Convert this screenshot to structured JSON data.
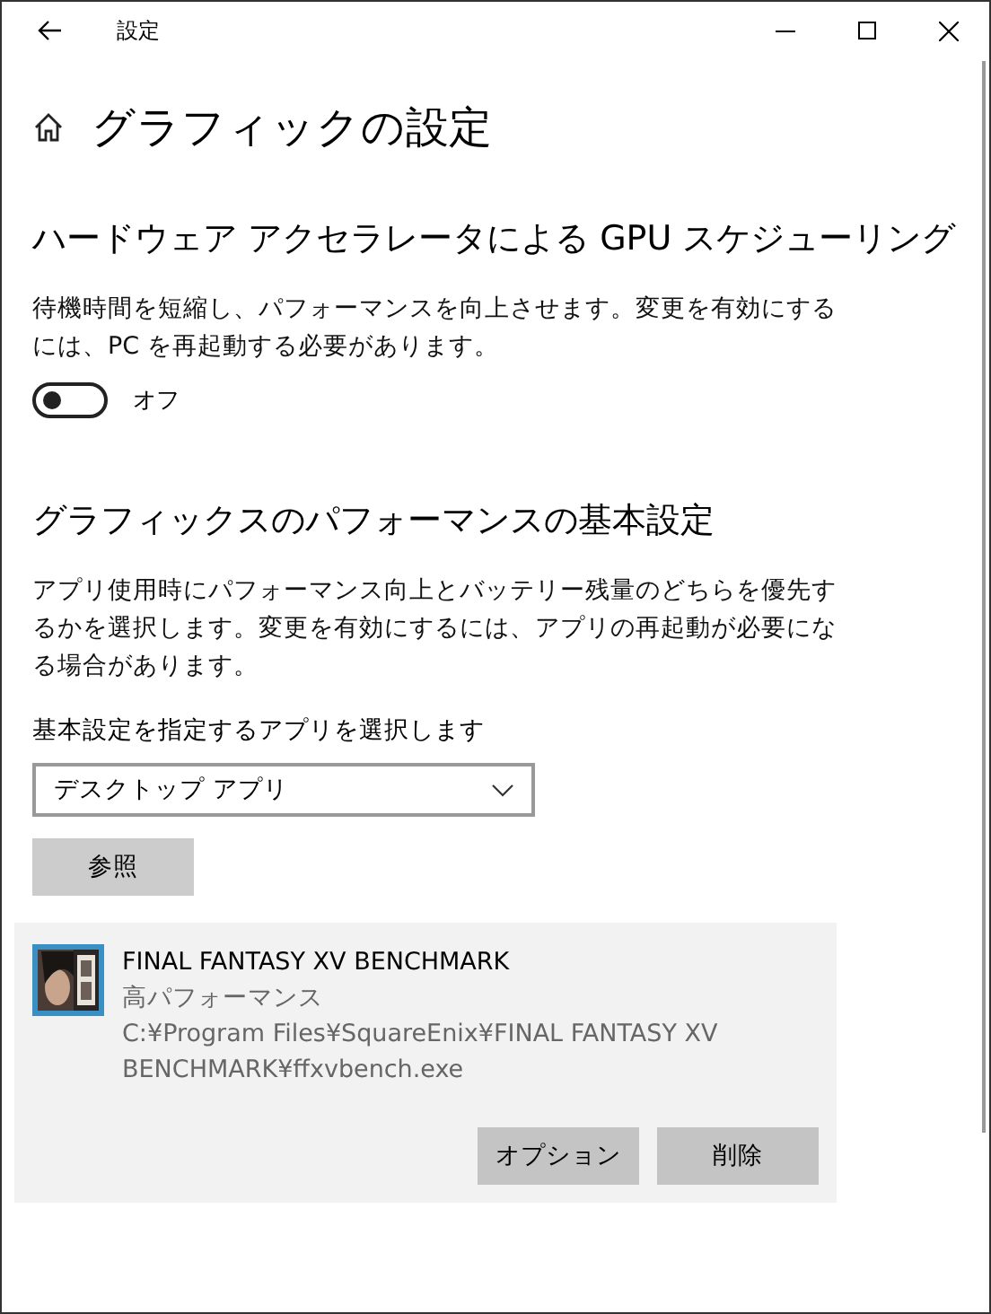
{
  "window": {
    "title": "設定"
  },
  "page_title": "グラフィックの設定",
  "gpu_scheduling": {
    "heading": "ハードウェア アクセラレータによる GPU スケジューリング",
    "description": "待機時間を短縮し、パフォーマンスを向上させます。変更を有効にするには、PC を再起動する必要があります。",
    "toggle": {
      "on": false,
      "label": "オフ"
    }
  },
  "performance": {
    "heading": "グラフィックスのパフォーマンスの基本設定",
    "description": "アプリ使用時にパフォーマンス向上とバッテリー残量のどちらを優先するかを選択します。変更を有効にするには、アプリの再起動が必要になる場合があります。",
    "select_label": "基本設定を指定するアプリを選択します",
    "select_value": "デスクトップ アプリ",
    "browse_button": "参照"
  },
  "apps": [
    {
      "name": "FINAL FANTASY XV BENCHMARK",
      "preference": "高パフォーマンス",
      "path": "C:¥Program Files¥SquareEnix¥FINAL FANTASY XV BENCHMARK¥ffxvbench.exe",
      "buttons": [
        "オプション",
        "削除"
      ]
    }
  ]
}
